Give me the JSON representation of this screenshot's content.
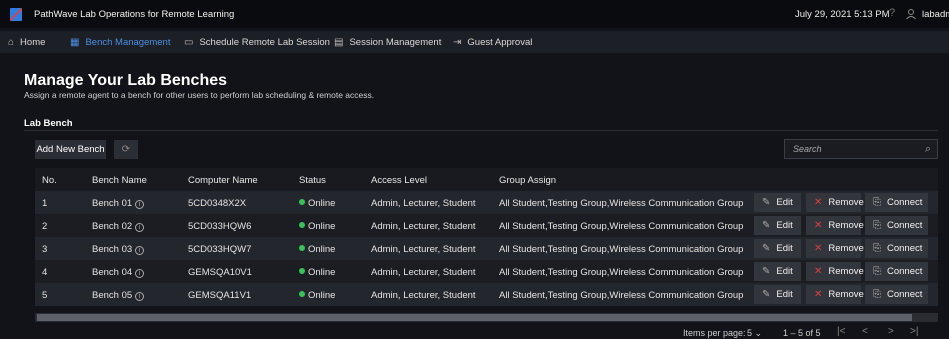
{
  "app": {
    "title": "PathWave Lab Operations for Remote Learning",
    "datetime": "July 29, 2021 5:13 PM",
    "user": "labadmin"
  },
  "nav": [
    {
      "label": "Home",
      "icon": "home-icon"
    },
    {
      "label": "Bench Management",
      "icon": "bench-icon"
    },
    {
      "label": "Schedule Remote Lab Session",
      "icon": "calendar-icon"
    },
    {
      "label": "Session Management",
      "icon": "session-icon"
    },
    {
      "label": "Guest Approval",
      "icon": "guest-icon"
    }
  ],
  "page": {
    "title": "Manage Your Lab Benches",
    "subtitle": "Assign a remote agent to a bench for other users to perform lab scheduling & remote access.",
    "section": "Lab Bench"
  },
  "toolbar": {
    "add_label": "Add New Bench",
    "search_placeholder": "Search"
  },
  "table": {
    "headers": [
      "No.",
      "Bench Name",
      "Computer Name",
      "Status",
      "Access Level",
      "Group Assign"
    ],
    "rows": [
      {
        "no": "1",
        "bench": "Bench 01",
        "computer": "5CD0348X2X",
        "status": "Online",
        "access": "Admin, Lecturer, Student",
        "group": "All Student,Testing Group,Wireless Communication Group"
      },
      {
        "no": "2",
        "bench": "Bench 02",
        "computer": "5CD033HQW6",
        "status": "Online",
        "access": "Admin, Lecturer, Student",
        "group": "All Student,Testing Group,Wireless Communication Group"
      },
      {
        "no": "3",
        "bench": "Bench 03",
        "computer": "5CD033HQW7",
        "status": "Online",
        "access": "Admin, Lecturer, Student",
        "group": "All Student,Testing Group,Wireless Communication Group"
      },
      {
        "no": "4",
        "bench": "Bench 04",
        "computer": "GEMSQA10V1",
        "status": "Online",
        "access": "Admin, Lecturer, Student",
        "group": "All Student,Testing Group,Wireless Communication Group"
      },
      {
        "no": "5",
        "bench": "Bench 05",
        "computer": "GEMSQA11V1",
        "status": "Online",
        "access": "Admin, Lecturer, Student",
        "group": "All Student,Testing Group,Wireless Communication Group"
      }
    ],
    "actions": {
      "edit": "Edit",
      "remove": "Remove",
      "connect": "Connect"
    }
  },
  "pager": {
    "items_label": "Items per page:",
    "per_page": "5",
    "range": "1 – 5 of 5"
  },
  "colors": {
    "accent": "#4a90e2",
    "online": "#3ac25a",
    "remove": "#d94040"
  }
}
